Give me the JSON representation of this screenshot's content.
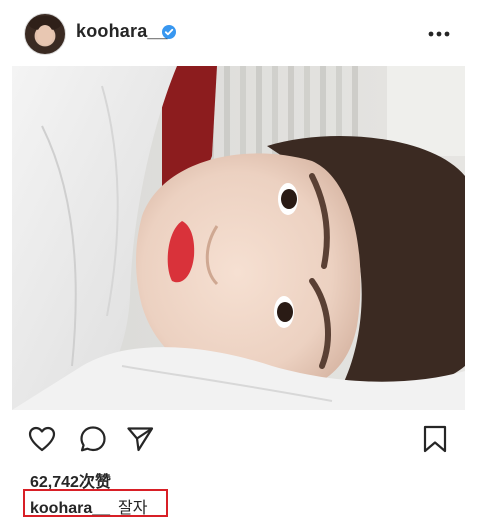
{
  "post": {
    "username": "koohara__",
    "verified": true,
    "likes_text": "62,742次赞",
    "caption_text": "잘자",
    "caption_highlighted": true
  },
  "icons": {
    "verified": "verified-badge-icon",
    "more": "more-options-icon",
    "like": "heart-icon",
    "comment": "comment-icon",
    "share": "send-icon",
    "save": "bookmark-icon"
  },
  "colors": {
    "verified_blue": "#3897f0",
    "highlight_red": "#d81f26",
    "text": "#262626"
  }
}
